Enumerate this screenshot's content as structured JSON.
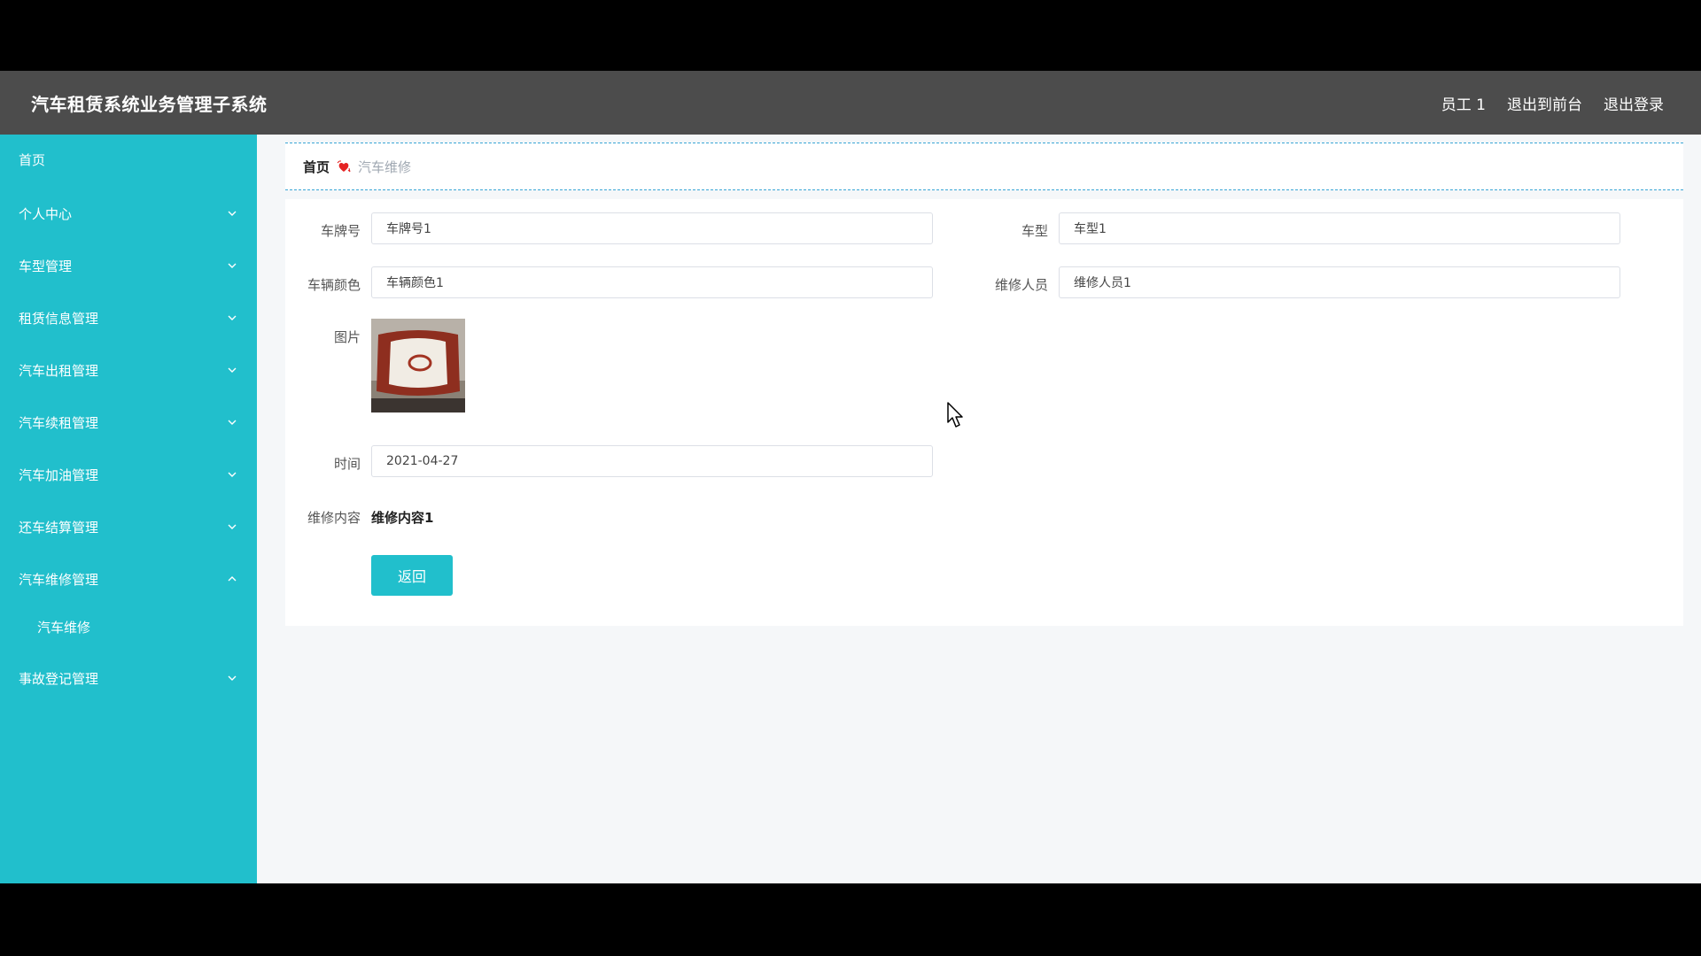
{
  "header": {
    "title": "汽车租赁系统业务管理子系统",
    "user": "员工 1",
    "to_frontend": "退出到前台",
    "logout": "退出登录"
  },
  "sidebar": {
    "items": [
      {
        "label": "首页"
      },
      {
        "label": "个人中心"
      },
      {
        "label": "车型管理"
      },
      {
        "label": "租赁信息管理"
      },
      {
        "label": "汽车出租管理"
      },
      {
        "label": "汽车续租管理"
      },
      {
        "label": "汽车加油管理"
      },
      {
        "label": "还车结算管理"
      },
      {
        "label": "汽车维修管理"
      },
      {
        "label": "汽车维修"
      },
      {
        "label": "事故登记管理"
      }
    ]
  },
  "breadcrumb": {
    "home": "首页",
    "current": "汽车维修"
  },
  "form": {
    "plate_label": "车牌号",
    "plate_value": "车牌号1",
    "model_label": "车型",
    "model_value": "车型1",
    "color_label": "车辆颜色",
    "color_value": "车辆颜色1",
    "staff_label": "维修人员",
    "staff_value": "维修人员1",
    "photo_label": "图片",
    "time_label": "时间",
    "time_value": "2021-04-27",
    "content_label": "维修内容",
    "content_value": "维修内容1",
    "back_label": "返回"
  },
  "colors": {
    "accent": "#21bfcc",
    "topbar": "#4c4c4c"
  }
}
